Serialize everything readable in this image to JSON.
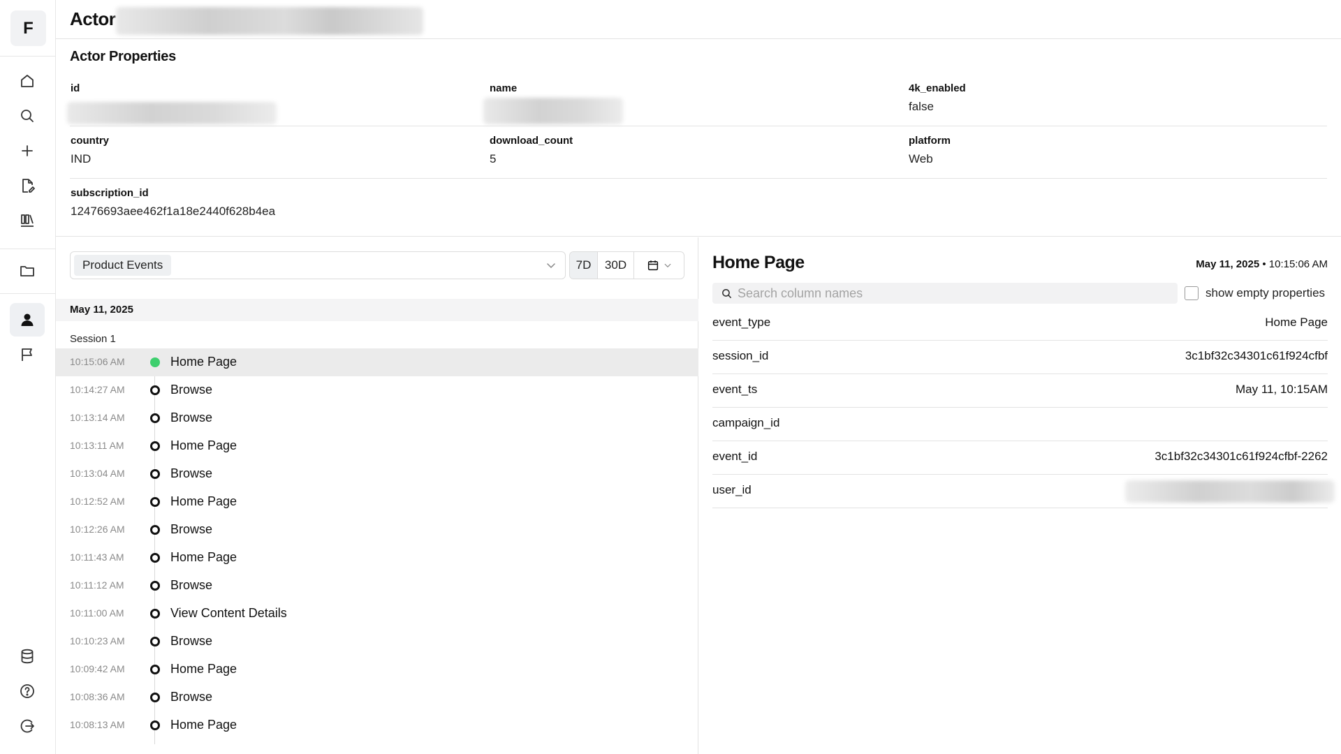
{
  "sidebar": {
    "logo": "F",
    "items": [
      {
        "icon": "home-icon"
      },
      {
        "icon": "search-icon"
      },
      {
        "icon": "plus-icon"
      },
      {
        "icon": "edit-file-icon"
      },
      {
        "icon": "flask-icon"
      },
      {
        "icon": "folder-icon"
      },
      {
        "icon": "user-icon",
        "active": true
      },
      {
        "icon": "flag-icon"
      },
      {
        "icon": "database-icon"
      },
      {
        "icon": "help-icon"
      },
      {
        "icon": "logout-icon"
      }
    ]
  },
  "header": {
    "title": "Actor"
  },
  "properties": {
    "title": "Actor Properties",
    "items": [
      {
        "key": "id",
        "value": ""
      },
      {
        "key": "name",
        "value": ""
      },
      {
        "key": "4k_enabled",
        "value": "false"
      },
      {
        "key": "country",
        "value": "IND"
      },
      {
        "key": "download_count",
        "value": "5"
      },
      {
        "key": "platform",
        "value": "Web"
      },
      {
        "key": "subscription_id",
        "value": "12476693aee462f1a18e2440f628b4ea"
      }
    ]
  },
  "events_panel": {
    "filter_value": "Product Events",
    "range_options": [
      "7D",
      "30D"
    ],
    "active_range": "7D",
    "date": "May 11, 2025",
    "session_label": "Session 1",
    "events": [
      {
        "time": "10:15:06 AM",
        "name": "Home Page",
        "selected": true
      },
      {
        "time": "10:14:27 AM",
        "name": "Browse"
      },
      {
        "time": "10:13:14 AM",
        "name": "Browse"
      },
      {
        "time": "10:13:11 AM",
        "name": "Home Page"
      },
      {
        "time": "10:13:04 AM",
        "name": "Browse"
      },
      {
        "time": "10:12:52 AM",
        "name": "Home Page"
      },
      {
        "time": "10:12:26 AM",
        "name": "Browse"
      },
      {
        "time": "10:11:43 AM",
        "name": "Home Page"
      },
      {
        "time": "10:11:12 AM",
        "name": "Browse"
      },
      {
        "time": "10:11:00 AM",
        "name": "View Content Details"
      },
      {
        "time": "10:10:23 AM",
        "name": "Browse"
      },
      {
        "time": "10:09:42 AM",
        "name": "Home Page"
      },
      {
        "time": "10:08:36 AM",
        "name": "Browse"
      },
      {
        "time": "10:08:13 AM",
        "name": "Home Page"
      }
    ]
  },
  "detail": {
    "title": "Home Page",
    "date_bold": "May 11, 2025",
    "date_sep": " • ",
    "time": "10:15:06 AM",
    "search_placeholder": "Search column names",
    "show_empty_label": "show empty properties",
    "show_empty_checked": false,
    "rows": [
      {
        "key": "event_type",
        "value": "Home Page"
      },
      {
        "key": "session_id",
        "value": "3c1bf32c34301c61f924cfbf"
      },
      {
        "key": "event_ts",
        "value": "May 11, 10:15AM"
      },
      {
        "key": "campaign_id",
        "value": ""
      },
      {
        "key": "event_id",
        "value": "3c1bf32c34301c61f924cfbf-2262"
      },
      {
        "key": "user_id",
        "value": ""
      }
    ]
  },
  "colors": {
    "accent_green": "#3ecf6e",
    "selected_row": "#ebebeb",
    "border": "#e3e3e3"
  }
}
